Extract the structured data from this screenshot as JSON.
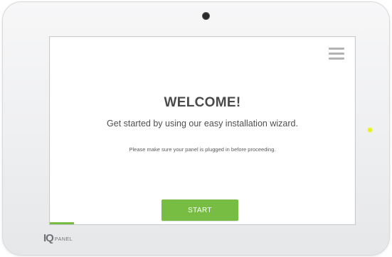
{
  "device": {
    "brand_mark": "IQ",
    "brand_word": "PANEL"
  },
  "screen": {
    "menu_icon": "hamburger-menu-icon",
    "title": "WELCOME!",
    "subtitle": "Get started by using our easy installation wizard.",
    "note": "Please make sure your panel is plugged in before proceeding.",
    "start_label": "START",
    "progress_fraction": 0.08
  },
  "colors": {
    "accent_green": "#78bd43",
    "status_led": "#e9f21c",
    "text_dark": "#4a4a4a"
  }
}
